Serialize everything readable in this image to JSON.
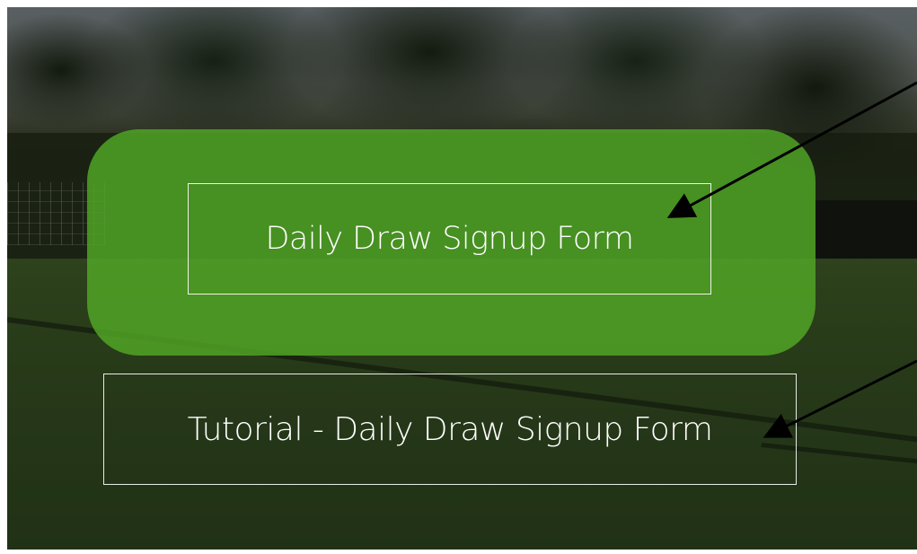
{
  "buttons": {
    "signup_label": "Daily Draw Signup Form",
    "tutorial_label": "Tutorial - Daily Draw Signup Form"
  },
  "colors": {
    "highlight_green": "#52a826",
    "button_text": "#ffffff",
    "arrow": "#000000"
  },
  "icons": {
    "annotation_arrow_1": "arrow-icon",
    "annotation_arrow_2": "arrow-icon"
  }
}
